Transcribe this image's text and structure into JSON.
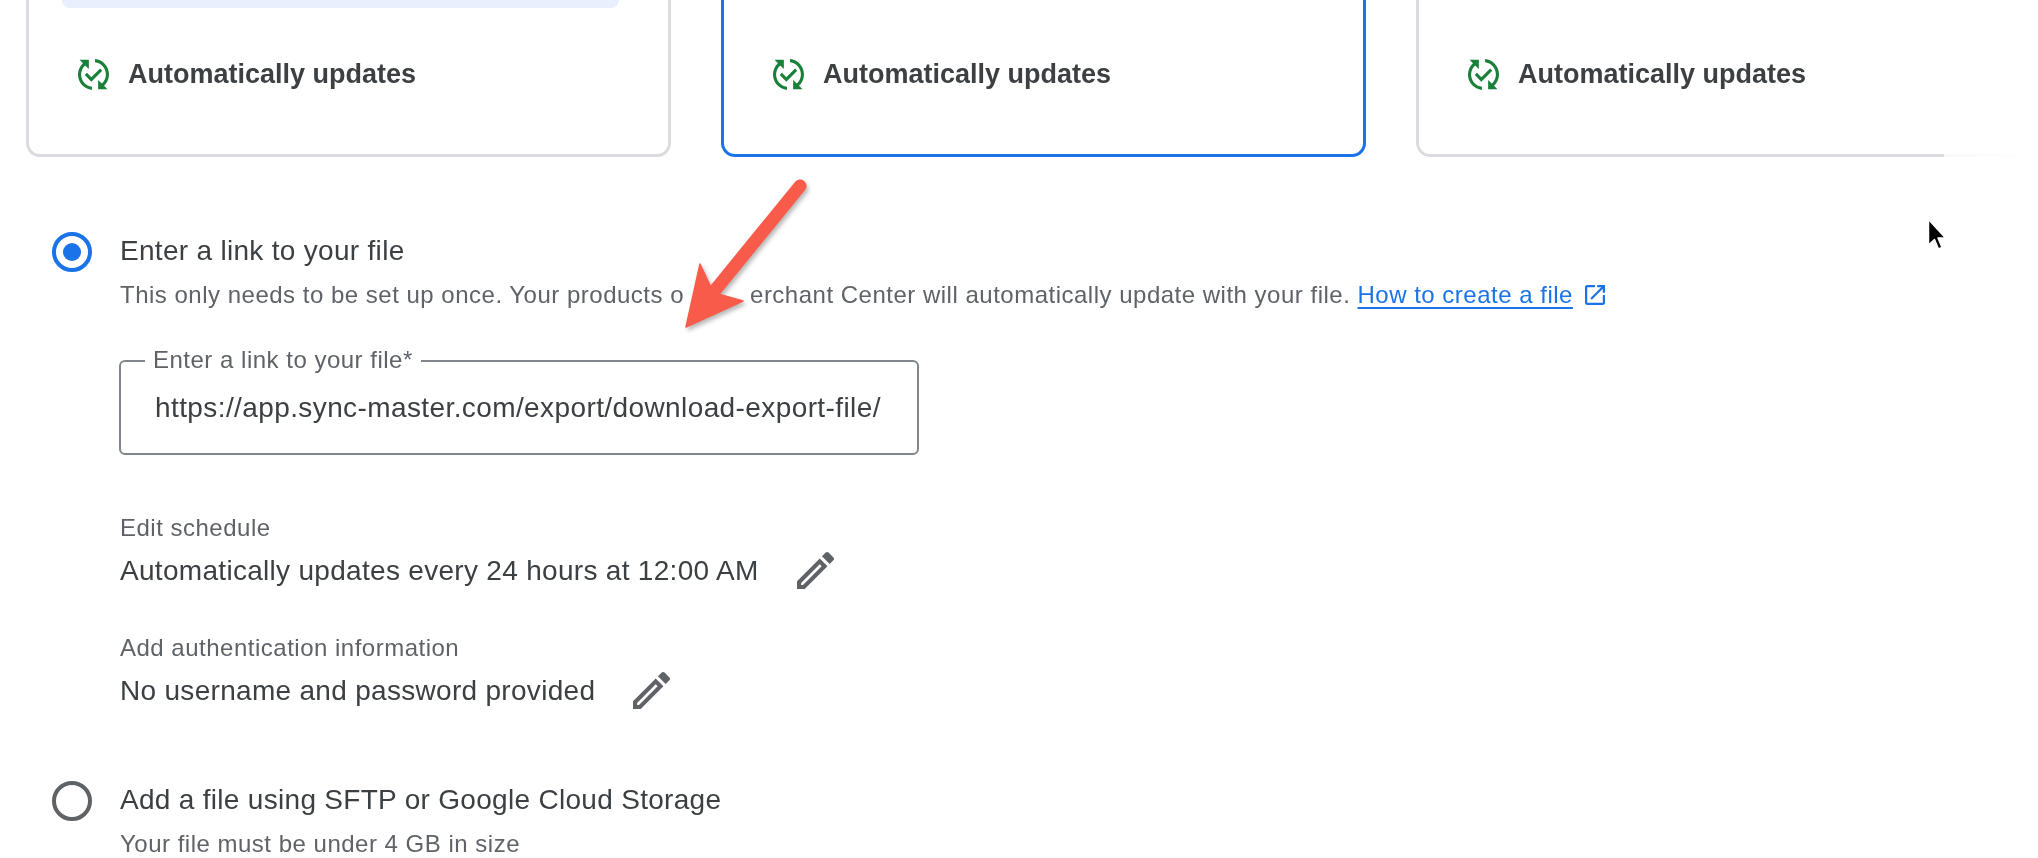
{
  "cards": [
    {
      "label": "Automatically updates",
      "selected": false,
      "tinted_panel": true
    },
    {
      "label": "Automatically updates",
      "selected": true,
      "tinted_panel": false
    },
    {
      "label": "Automatically updates",
      "selected": false,
      "tinted_panel": false
    }
  ],
  "options": [
    {
      "title": "Enter a link to your file",
      "selected": true,
      "description_parts": [
        "This only needs to be set up once. Your products o",
        "erchant Center will automatically update with your file."
      ],
      "link": "How to create a file",
      "field": {
        "label": "Enter a link to your file*",
        "value": "https://app.sync-master.com/export/download-export-file/"
      },
      "settings": [
        {
          "label": "Edit schedule",
          "value": "Automatically updates every 24 hours at 12:00 AM"
        },
        {
          "label": "Add authentication information",
          "value": "No username and password provided"
        }
      ]
    },
    {
      "title": "Add a file using SFTP or Google Cloud Storage",
      "selected": false,
      "description_parts": [
        "Your file must be under 4 GB in size"
      ]
    }
  ]
}
